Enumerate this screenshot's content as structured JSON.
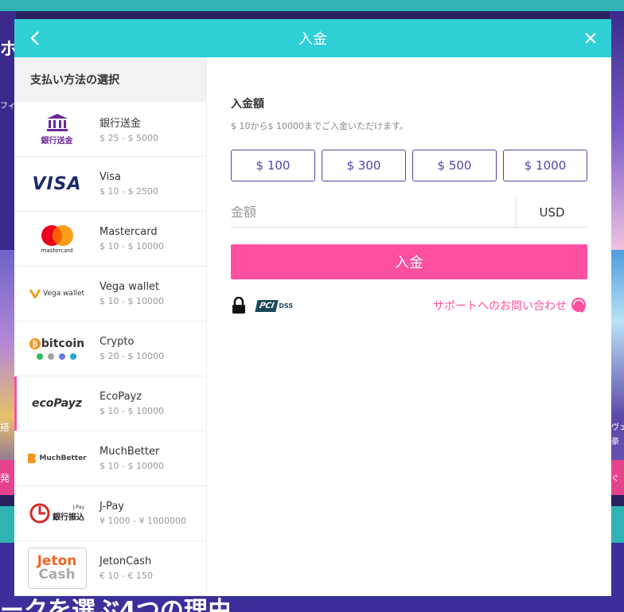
{
  "background": {
    "left_text_1": "ホ",
    "left_text_2": "フィ",
    "left_text_3": "搭",
    "left_text_4": "発",
    "right_text_1": "ヴェ",
    "right_text_2": "豪",
    "right_text_3": "ぐ",
    "headline": "ークを選ぶ4つの理由"
  },
  "modal": {
    "title": "入金",
    "back_icon": "chevron-left-icon",
    "close_icon": "close-icon"
  },
  "sidebar": {
    "title": "支払い方法の選択",
    "methods": [
      {
        "name": "銀行送金",
        "range": "$ 25 - $ 5000",
        "logo": "bank-transfer-logo",
        "logo_text": "銀行送金"
      },
      {
        "name": "Visa",
        "range": "$ 10 - $ 2500",
        "logo": "visa-logo",
        "logo_text": "VISA"
      },
      {
        "name": "Mastercard",
        "range": "$ 10 - $ 10000",
        "logo": "mastercard-logo",
        "logo_text": "mastercard"
      },
      {
        "name": "Vega wallet",
        "range": "$ 10 - $ 10000",
        "logo": "vega-wallet-logo",
        "logo_text": "Vega wallet"
      },
      {
        "name": "Crypto",
        "range": "$ 20 - $ 10000",
        "logo": "bitcoin-logo",
        "logo_text": "bitcoin"
      },
      {
        "name": "EcoPayz",
        "range": "$ 10 - $ 10000",
        "logo": "ecopayz-logo",
        "logo_text": "ecoPayz",
        "active": true
      },
      {
        "name": "MuchBetter",
        "range": "$ 10 - $ 10000",
        "logo": "muchbetter-logo",
        "logo_text": "MuchBetter"
      },
      {
        "name": "J-Pay",
        "range": "¥ 1000 - ¥ 1000000",
        "logo": "jpay-logo",
        "logo_text": "銀行振込",
        "logo_subtext": "J-Pay"
      },
      {
        "name": "JetonCash",
        "range": "€ 10 - € 150",
        "logo": "jetoncash-logo",
        "logo_text": "Jeton",
        "logo_subtext": "Cash"
      }
    ]
  },
  "deposit": {
    "title": "入金額",
    "hint": "$ 10から$ 10000までご入金いただけます。",
    "presets": [
      "$ 100",
      "$ 300",
      "$ 500",
      "$ 1000"
    ],
    "amount_placeholder": "金額",
    "amount_value": "",
    "currency": "USD",
    "submit_label": "入金",
    "pci_label": "PCI",
    "pci_sublabel": "DSS",
    "support_label": "サポートへのお問い合わせ"
  },
  "colors": {
    "header": "#2fcfd6",
    "accent": "#ff4fa0",
    "preset_border": "#4a4aa8"
  }
}
